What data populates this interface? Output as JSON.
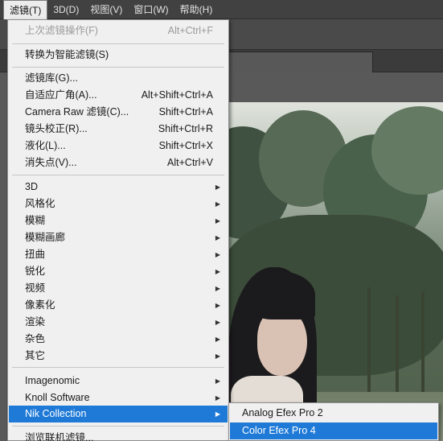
{
  "menubar": {
    "items": [
      {
        "label": "滤镜(T)"
      },
      {
        "label": "3D(D)"
      },
      {
        "label": "视图(V)"
      },
      {
        "label": "窗口(W)"
      },
      {
        "label": "帮助(H)"
      }
    ]
  },
  "filter_menu": {
    "last_filter": {
      "label": "上次滤镜操作(F)",
      "shortcut": "Alt+Ctrl+F"
    },
    "convert_smart": {
      "label": "转换为智能滤镜(S)"
    },
    "filter_gallery": {
      "label": "滤镜库(G)..."
    },
    "adaptive_wide": {
      "label": "自适应广角(A)...",
      "shortcut": "Alt+Shift+Ctrl+A"
    },
    "camera_raw": {
      "label": "Camera Raw 滤镜(C)...",
      "shortcut": "Shift+Ctrl+A"
    },
    "lens_correction": {
      "label": "镜头校正(R)...",
      "shortcut": "Shift+Ctrl+R"
    },
    "liquify": {
      "label": "液化(L)...",
      "shortcut": "Shift+Ctrl+X"
    },
    "vanishing_point": {
      "label": "消失点(V)...",
      "shortcut": "Alt+Ctrl+V"
    },
    "groups": [
      {
        "label": "3D"
      },
      {
        "label": "风格化"
      },
      {
        "label": "模糊"
      },
      {
        "label": "模糊画廊"
      },
      {
        "label": "扭曲"
      },
      {
        "label": "锐化"
      },
      {
        "label": "视频"
      },
      {
        "label": "像素化"
      },
      {
        "label": "渲染"
      },
      {
        "label": "杂色"
      },
      {
        "label": "其它"
      }
    ],
    "plugins": [
      {
        "label": "Imagenomic"
      },
      {
        "label": "Knoll Software"
      },
      {
        "label": "Nik Collection"
      }
    ],
    "browse_online": {
      "label": "浏览联机滤镜..."
    }
  },
  "nik_submenu": {
    "items": [
      {
        "label": "Analog Efex Pro 2"
      },
      {
        "label": "Color Efex Pro 4"
      }
    ]
  },
  "icons": {
    "submenu_arrow": "▶"
  },
  "colors": {
    "highlight": "#1f7ad7",
    "menu_bg": "#f0f0f0",
    "menubar_bg": "#414141"
  }
}
